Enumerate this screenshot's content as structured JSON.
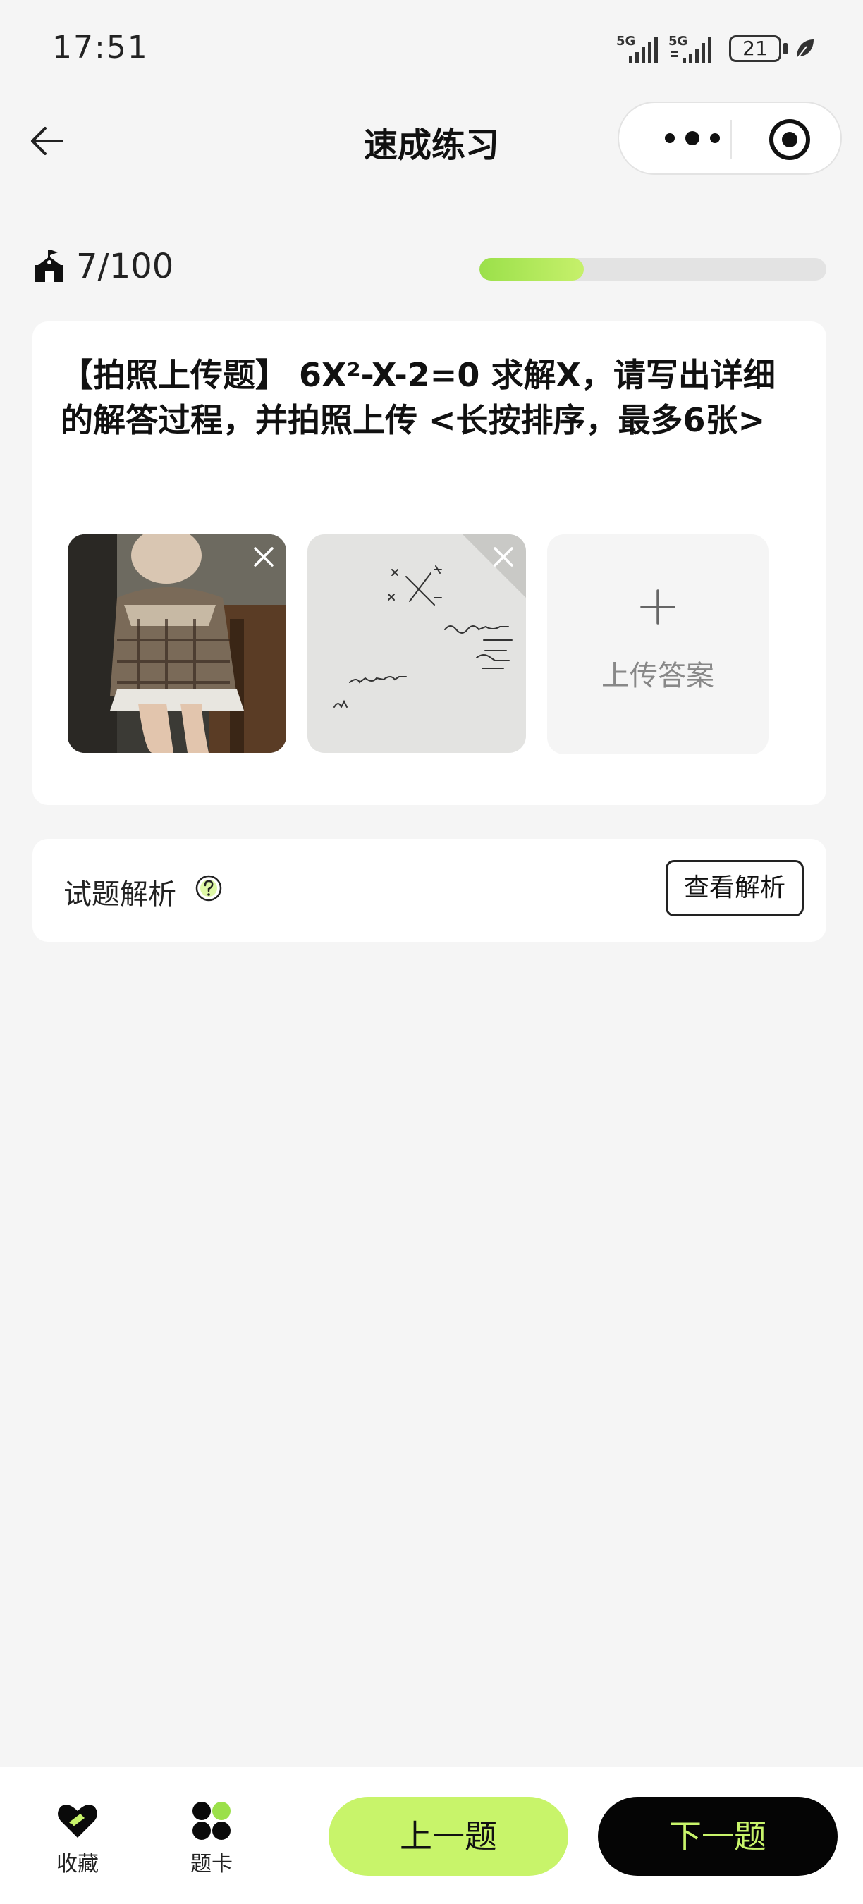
{
  "status_bar": {
    "time": "17:51",
    "signal1": "5G",
    "signal2": "5G",
    "battery": "21"
  },
  "nav": {
    "title": "速成练习"
  },
  "progress": {
    "text": "7/100",
    "fraction": 0.3
  },
  "question": {
    "text": "【拍照上传题】 6X²-X-2=0 求解X，请写出详细的解答过程，并拍照上传 <长按排序，最多6张>",
    "upload_label": "上传答案"
  },
  "analysis": {
    "title": "试题解析",
    "button": "查看解析"
  },
  "bottom": {
    "favorite": "收藏",
    "card": "题卡",
    "prev": "上一题",
    "next": "下一题"
  },
  "colors": {
    "accent": "#c8f46a",
    "progress": "#9be04a",
    "dark": "#050505"
  }
}
